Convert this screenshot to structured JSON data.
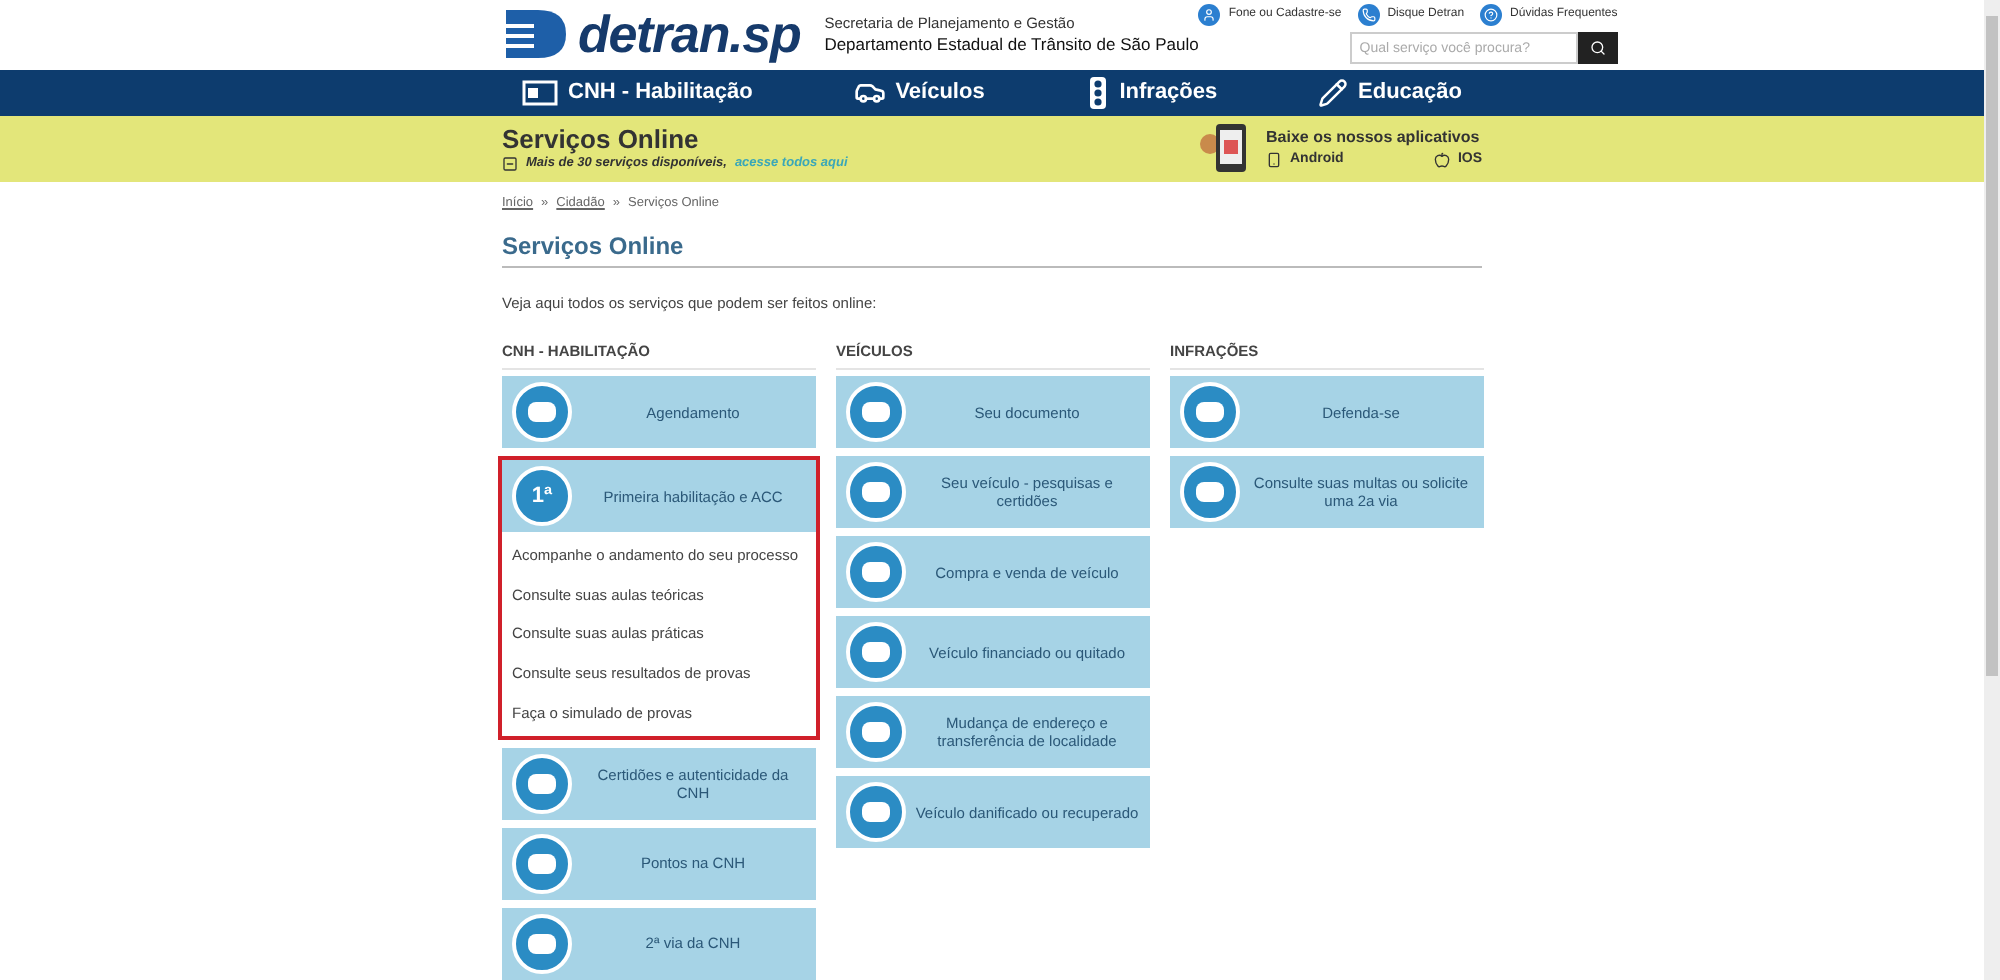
{
  "header": {
    "logo": "detran.sp",
    "org_line1": "Secretaria de Planejamento e Gestão",
    "org_line2": "Departamento Estadual de Trânsito de São Paulo",
    "top_links": [
      "Fone ou Cadastre-se",
      "Disque Detran",
      "Dúvidas Frequentes"
    ],
    "search": {
      "placeholder": "Qual serviço você procura?"
    }
  },
  "nav": [
    {
      "label": "CNH - Habilitação",
      "kind": "card"
    },
    {
      "label": "Veículos",
      "kind": "car"
    },
    {
      "label": "Infrações",
      "kind": "light"
    },
    {
      "label": "Educação",
      "kind": "pencil"
    }
  ],
  "banner": {
    "title": "Serviços Online",
    "subtitle": "Mais de 30 serviços disponíveis,",
    "link": "acesse todos aqui",
    "apps_title": "Baixe os nossos aplicativos",
    "apps": [
      "Android",
      "IOS"
    ]
  },
  "breadcrumb": [
    "Início",
    "Cidadão",
    "Serviços Online"
  ],
  "breadcrumb_separator": "»",
  "page_title": "Serviços Online",
  "intro": "Veja aqui todos os serviços que podem ser feitos online:",
  "columns": [
    {
      "heading": "CNH - HABILITAÇÃO",
      "cards": [
        {
          "label": "Agendamento",
          "expanded": false
        },
        {
          "label": "Primeira habilitação e ACC",
          "expanded": true,
          "icon_text": "1ª",
          "links": [
            "Acompanhe o andamento do seu processo",
            "Consulte suas aulas teóricas",
            "Consulte suas aulas práticas",
            "Consulte seus resultados de provas",
            "Faça o simulado de provas"
          ]
        },
        {
          "label": "Certidões e autenticidade da CNH",
          "expanded": false
        },
        {
          "label": "Pontos na CNH",
          "expanded": false
        },
        {
          "label": "2ª via da CNH",
          "expanded": false
        }
      ]
    },
    {
      "heading": "VEÍCULOS",
      "cards": [
        {
          "label": "Seu documento",
          "expanded": false
        },
        {
          "label": "Seu veículo - pesquisas e certidões",
          "expanded": false
        },
        {
          "label": "Compra e venda de veículo",
          "expanded": false
        },
        {
          "label": "Veículo financiado ou quitado",
          "expanded": false
        },
        {
          "label": "Mudança de endereço e transferência de localidade",
          "expanded": false
        },
        {
          "label": "Veículo danificado ou recuperado",
          "expanded": false
        }
      ]
    },
    {
      "heading": "INFRAÇÕES",
      "cards": [
        {
          "label": "Defenda-se",
          "expanded": false
        },
        {
          "label": "Consulte suas multas ou solicite uma 2a via",
          "expanded": false
        }
      ]
    }
  ]
}
